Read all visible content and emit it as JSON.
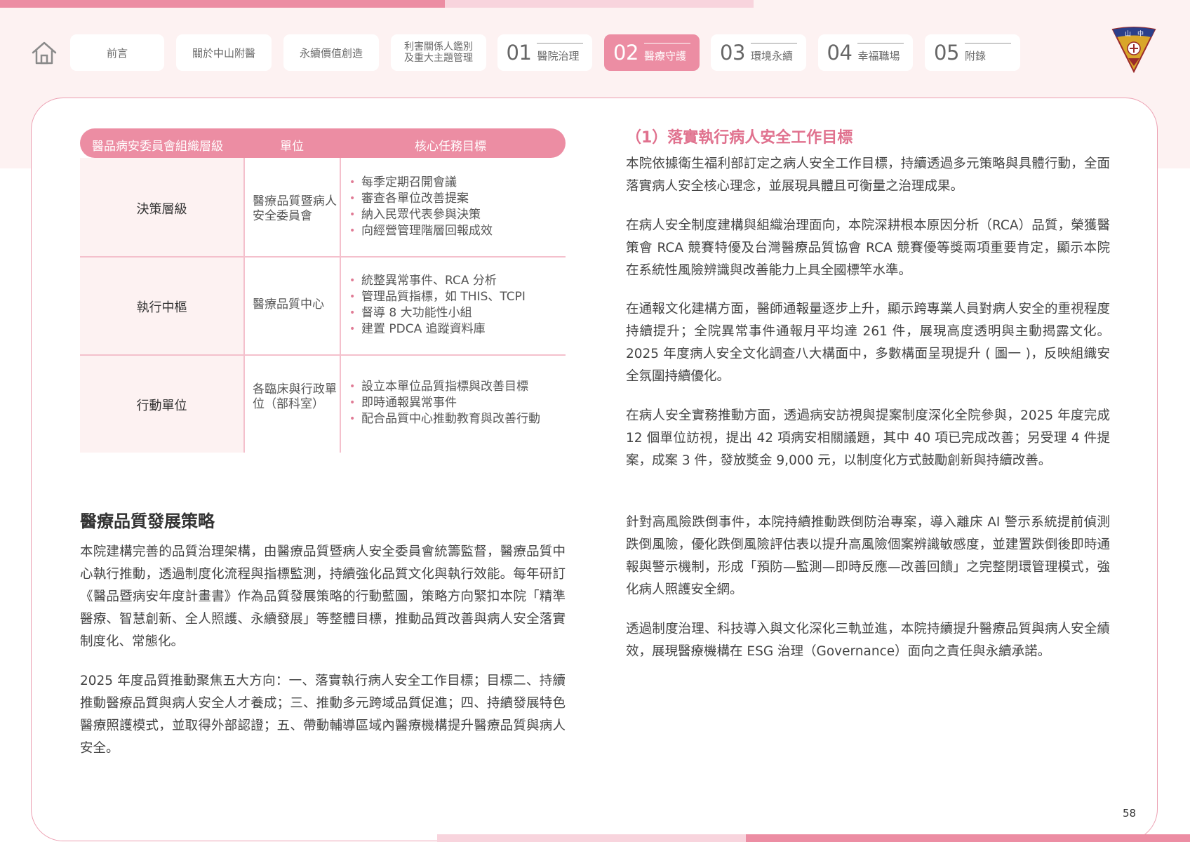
{
  "nav": {
    "tabs": [
      {
        "label": "前言"
      },
      {
        "label": "關於中山附醫"
      },
      {
        "label": "永續價值創造"
      },
      {
        "label": "利害關係人鑑別\n及重大主題管理"
      },
      {
        "num": "01",
        "label": "醫院治理"
      },
      {
        "num": "02",
        "label": "醫療守護",
        "active": true
      },
      {
        "num": "03",
        "label": "環境永續"
      },
      {
        "num": "04",
        "label": "幸福職場"
      },
      {
        "num": "05",
        "label": "附錄"
      }
    ],
    "logo_text": "山中醫"
  },
  "table": {
    "headers": [
      "醫品病安委員會組織層級",
      "單位",
      "核心任務目標"
    ],
    "rows": [
      {
        "level": "決策層級",
        "unit": "醫療品質暨病人安全委員會",
        "tasks": [
          "每季定期召開會議",
          "審查各單位改善提案",
          "納入民眾代表參與決策",
          "向經營管理階層回報成效"
        ]
      },
      {
        "level": "執行中樞",
        "unit": "醫療品質中心",
        "tasks": [
          "統整異常事件、RCA 分析",
          "管理品質指標，如 THIS、TCPI",
          "督導 8 大功能性小組",
          "建置 PDCA 追蹤資料庫"
        ]
      },
      {
        "level": "行動單位",
        "unit": "各臨床與行政單位（部科室）",
        "tasks": [
          "設立本單位品質指標與改善目標",
          "即時通報異常事件",
          "配合品質中心推動教育與改善行動"
        ]
      }
    ]
  },
  "left": {
    "heading": "醫療品質發展策略",
    "paragraphs": [
      "本院建構完善的品質治理架構，由醫療品質暨病人安全委員會統籌監督，醫療品質中心執行推動，透過制度化流程與指標監測，持續強化品質文化與執行效能。每年研訂《醫品暨病安年度計畫書》作為品質發展策略的行動藍圖，策略方向緊扣本院「精準醫療、智慧創新、全人照護、永續發展」等整體目標，推動品質改善與病人安全落實制度化、常態化。",
      "2025 年度品質推動聚焦五大方向：一、落實執行病人安全工作目標；目標二、持續推動醫療品質與病人安全人才養成；三、推動多元跨域品質促進；四、持續發展特色醫療照護模式，並取得外部認證；五、帶動輔導區域內醫療機構提升醫療品質與病人安全。"
    ]
  },
  "right": {
    "heading": "（1）落實執行病人安全工作目標",
    "paragraphs": [
      "本院依據衛生福利部訂定之病人安全工作目標，持續透過多元策略與具體行動，全面落實病人安全核心理念，並展現具體且可衡量之治理成果。",
      "在病人安全制度建構與組織治理面向，本院深耕根本原因分析（RCA）品質，榮獲醫策會 RCA 競賽特優及台灣醫療品質協會 RCA 競賽優等獎兩項重要肯定，顯示本院在系統性風險辨識與改善能力上具全國標竿水準。",
      "在通報文化建構方面，醫師通報量逐步上升，顯示跨專業人員對病人安全的重視程度持續提升；全院異常事件通報月平均達 261 件，展現高度透明與主動揭露文化。2025 年度病人安全文化調查八大構面中，多數構面呈現提升 ( 圖一 )，反映組織安全氛圍持續優化。",
      "在病人安全實務推動方面，透過病安訪視與提案制度深化全院參與，2025 年度完成 12 個單位訪視，提出 42 項病安相關議題，其中 40 項已完成改善；另受理 4 件提案，成案 3 件，發放獎金 9,000 元，以制度化方式鼓勵創新與持續改善。",
      "針對高風險跌倒事件，本院持續推動跌倒防治專案，導入離床 AI 警示系統提前偵測跌倒風險，優化跌倒風險評估表以提升高風險個案辨識敏感度，並建置跌倒後即時通報與警示機制，形成「預防—監測—即時反應—改善回饋」之完整閉環管理模式，強化病人照護安全網。",
      "透過制度治理、科技導入與文化深化三軌並進，本院持續提升醫療品質與病人安全績效，展現醫療機構在 ESG 治理（Governance）面向之責任與永續承諾。"
    ]
  },
  "page_number": "58",
  "colors": {
    "accent": "#ec8da3",
    "accent_light": "#f8d4dd",
    "heading_pink": "#e0718e",
    "bg_tint": "#fdf2f2"
  }
}
